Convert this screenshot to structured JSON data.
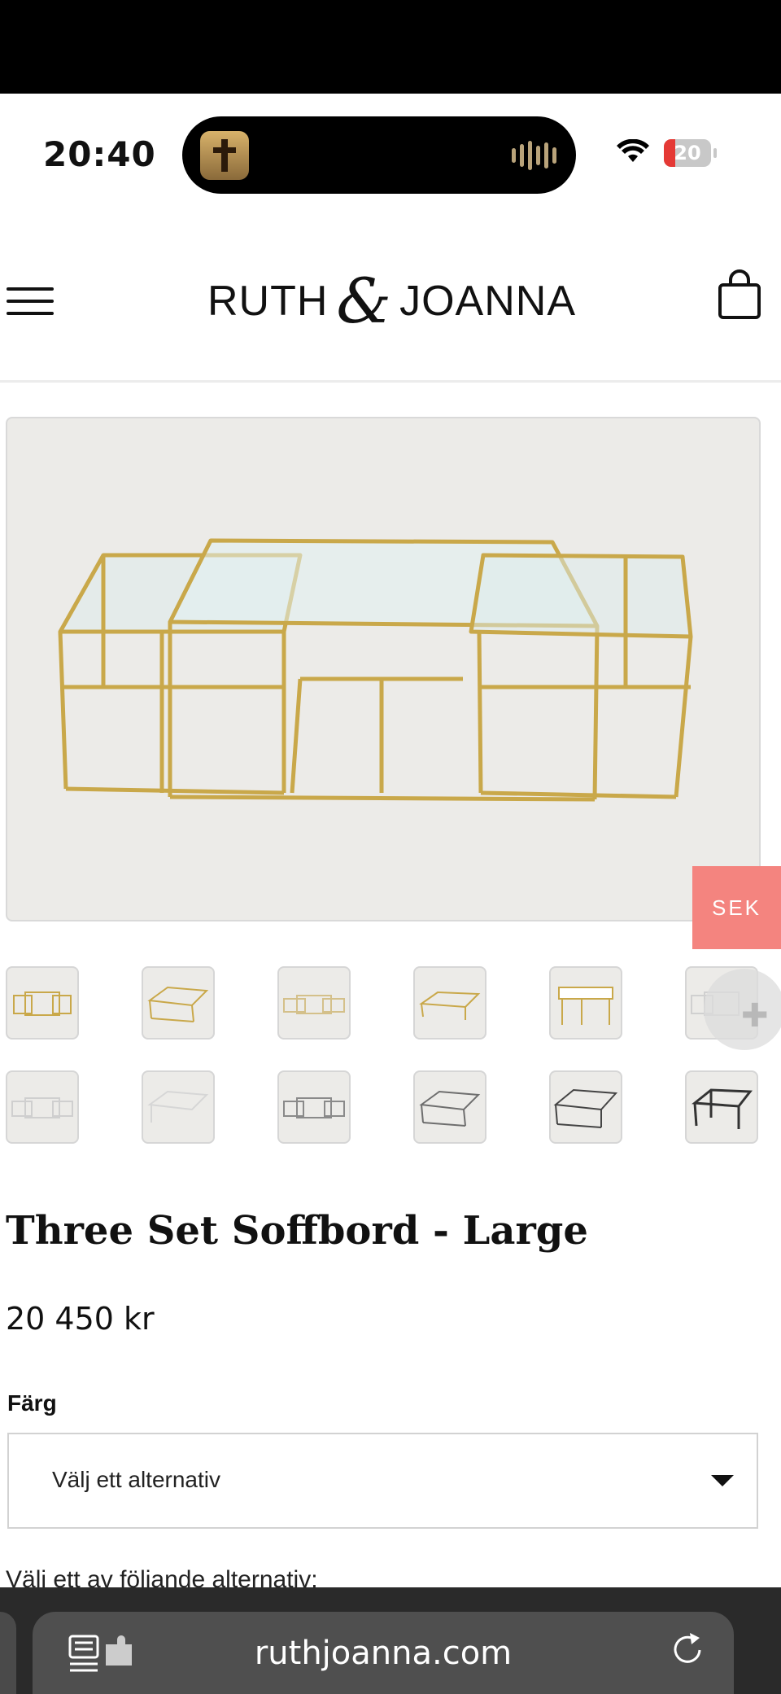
{
  "status_bar": {
    "time": "20:40",
    "battery_level": "20"
  },
  "header": {
    "logo_left": "RUTH",
    "logo_amp": "&",
    "logo_right": "JOANNA"
  },
  "currency_badge": "SEK",
  "product": {
    "title": "Three Set Soffbord - Large",
    "price": "20 450 kr",
    "color_label": "Färg",
    "color_select_value": "Välj ett alternativ",
    "choose_text": "Välj ett av följande alternativ:"
  },
  "browser": {
    "url": "ruthjoanna.com"
  },
  "colors": {
    "accent_badge": "#f4847f",
    "gold": "#c9a84a",
    "silver": "#c8c8c8",
    "black_frame": "#3a3a3a"
  },
  "icons": [
    "menu-icon",
    "shopping-bag-icon",
    "wifi-icon",
    "battery-icon",
    "reader-mode-icon",
    "extension-icon",
    "reload-icon"
  ]
}
